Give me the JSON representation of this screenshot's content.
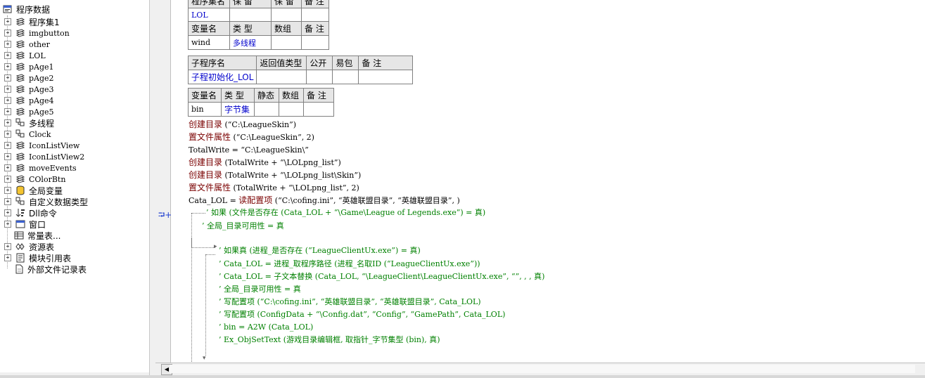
{
  "tree": {
    "root_label": "程序数据",
    "items": [
      {
        "label": "程序集1",
        "icon": "book-stack-icon",
        "toggle": "+"
      },
      {
        "label": "imgbutton",
        "icon": "book-stack-icon",
        "toggle": "+"
      },
      {
        "label": "other",
        "icon": "book-stack-icon",
        "toggle": "+"
      },
      {
        "label": "LOL",
        "icon": "book-stack-icon",
        "toggle": "+"
      },
      {
        "label": "pAge1",
        "icon": "book-stack-icon",
        "toggle": "+"
      },
      {
        "label": "pAge2",
        "icon": "book-stack-icon",
        "toggle": "+"
      },
      {
        "label": "pAge3",
        "icon": "book-stack-icon",
        "toggle": "+"
      },
      {
        "label": "pAge4",
        "icon": "book-stack-icon",
        "toggle": "+"
      },
      {
        "label": "pAge5",
        "icon": "book-stack-icon",
        "toggle": "+"
      },
      {
        "label": "多线程",
        "icon": "class-module-icon",
        "toggle": "+"
      },
      {
        "label": "Clock",
        "icon": "class-module-icon",
        "toggle": "+"
      },
      {
        "label": "IconListView",
        "icon": "book-stack-icon",
        "toggle": "+"
      },
      {
        "label": "IconListView2",
        "icon": "book-stack-icon",
        "toggle": "+"
      },
      {
        "label": "moveEvents",
        "icon": "book-stack-icon",
        "toggle": "+"
      },
      {
        "label": "COlorBtn",
        "icon": "book-stack-icon",
        "toggle": "+"
      },
      {
        "label": "全局变量",
        "icon": "database-icon",
        "toggle": "+"
      },
      {
        "label": "自定义数据类型",
        "icon": "class-module-icon",
        "toggle": "+"
      },
      {
        "label": "Dll命令",
        "icon": "sort-icon",
        "toggle": "+"
      },
      {
        "label": "窗口",
        "icon": "window-icon",
        "toggle": "+"
      },
      {
        "label": "常量表...",
        "icon": "constant-table-icon",
        "toggle": ""
      },
      {
        "label": "资源表",
        "icon": "resource-icon",
        "toggle": "+"
      },
      {
        "label": "模块引用表",
        "icon": "module-ref-icon",
        "toggle": "+"
      },
      {
        "label": "外部文件记录表",
        "icon": "file-record-icon",
        "toggle": ""
      }
    ]
  },
  "editor": {
    "assembly_table": {
      "headers": [
        "程序集名",
        "保 留",
        "保 留",
        "备 注"
      ],
      "row": [
        "LOL",
        "",
        "",
        ""
      ]
    },
    "assembly_vars": {
      "headers": [
        "变量名",
        "类 型",
        "数组",
        "备 注"
      ],
      "row": [
        "wind",
        "多线程",
        "",
        ""
      ]
    },
    "sub_table": {
      "headers": [
        "子程序名",
        "返回值类型",
        "公开",
        "易包",
        "备 注"
      ],
      "row": [
        "子程初始化_LOL",
        "",
        "",
        "",
        ""
      ]
    },
    "local_vars": {
      "headers": [
        "变量名",
        "类 型",
        "静态",
        "数组",
        "备 注"
      ],
      "row": [
        "bin",
        "字节集",
        "",
        "",
        ""
      ]
    },
    "lines": [
      {
        "fn": "创建目录",
        "args": " (“C:\\LeagueSkin”)"
      },
      {
        "fn": "置文件属性",
        "args": " (“C:\\LeagueSkin”, 2)"
      },
      {
        "fn": "",
        "args": "TotalWrite = “C:\\LeagueSkin\\”"
      },
      {
        "fn": "创建目录",
        "args": " (TotalWrite + “\\LOLpng_list”)"
      },
      {
        "fn": "创建目录",
        "args": " (TotalWrite + “\\LOLpng_list\\Skin”)"
      },
      {
        "fn": "置文件属性",
        "args": " (TotalWrite + “\\LOLpng_list”, 2)"
      },
      {
        "fn": "",
        "args": "Cata_LOL = ",
        "fn2": "读配置项",
        "args2": " (“C:\\cofing.ini”, “英雄联盟目录”, “英雄联盟目录”, )"
      }
    ],
    "comments": [
      "’ 如果 (文件是否存在 (Cata_LOL + “\\Game\\League of Legends.exe”) = 真)",
      "’ 全局_目录可用性 = 真",
      "’ 如果真 (进程_是否存在 (“LeagueClientUx.exe”) = 真)",
      "’ Cata_LOL = 进程_取程序路径 (进程_名取ID (“LeagueClientUx.exe”))",
      "’ Cata_LOL = 子文本替换 (Cata_LOL, “\\LeagueClient\\LeagueClientUx.exe”, “”, , , 真)",
      "’ 全局_目录可用性 = 真",
      "’ 写配置项 (“C:\\cofing.ini”, “英雄联盟目录”, “英雄联盟目录”, Cata_LOL)",
      "’ 写配置项 (ConfigData + “\\Config.dat”, “Config”, “GamePath”, Cata_LOL)",
      "’ bin = A2W (Cata_LOL)",
      "’ Ex_ObjSetText (游戏目录编辑框, 取指针_字节集型 (bin), 真)"
    ],
    "gutter_marker": "⮒+"
  },
  "colors": {
    "function": "#7a0000",
    "comment": "#008000",
    "type": "#0000cc",
    "header_bg": "#e6e6e6"
  }
}
